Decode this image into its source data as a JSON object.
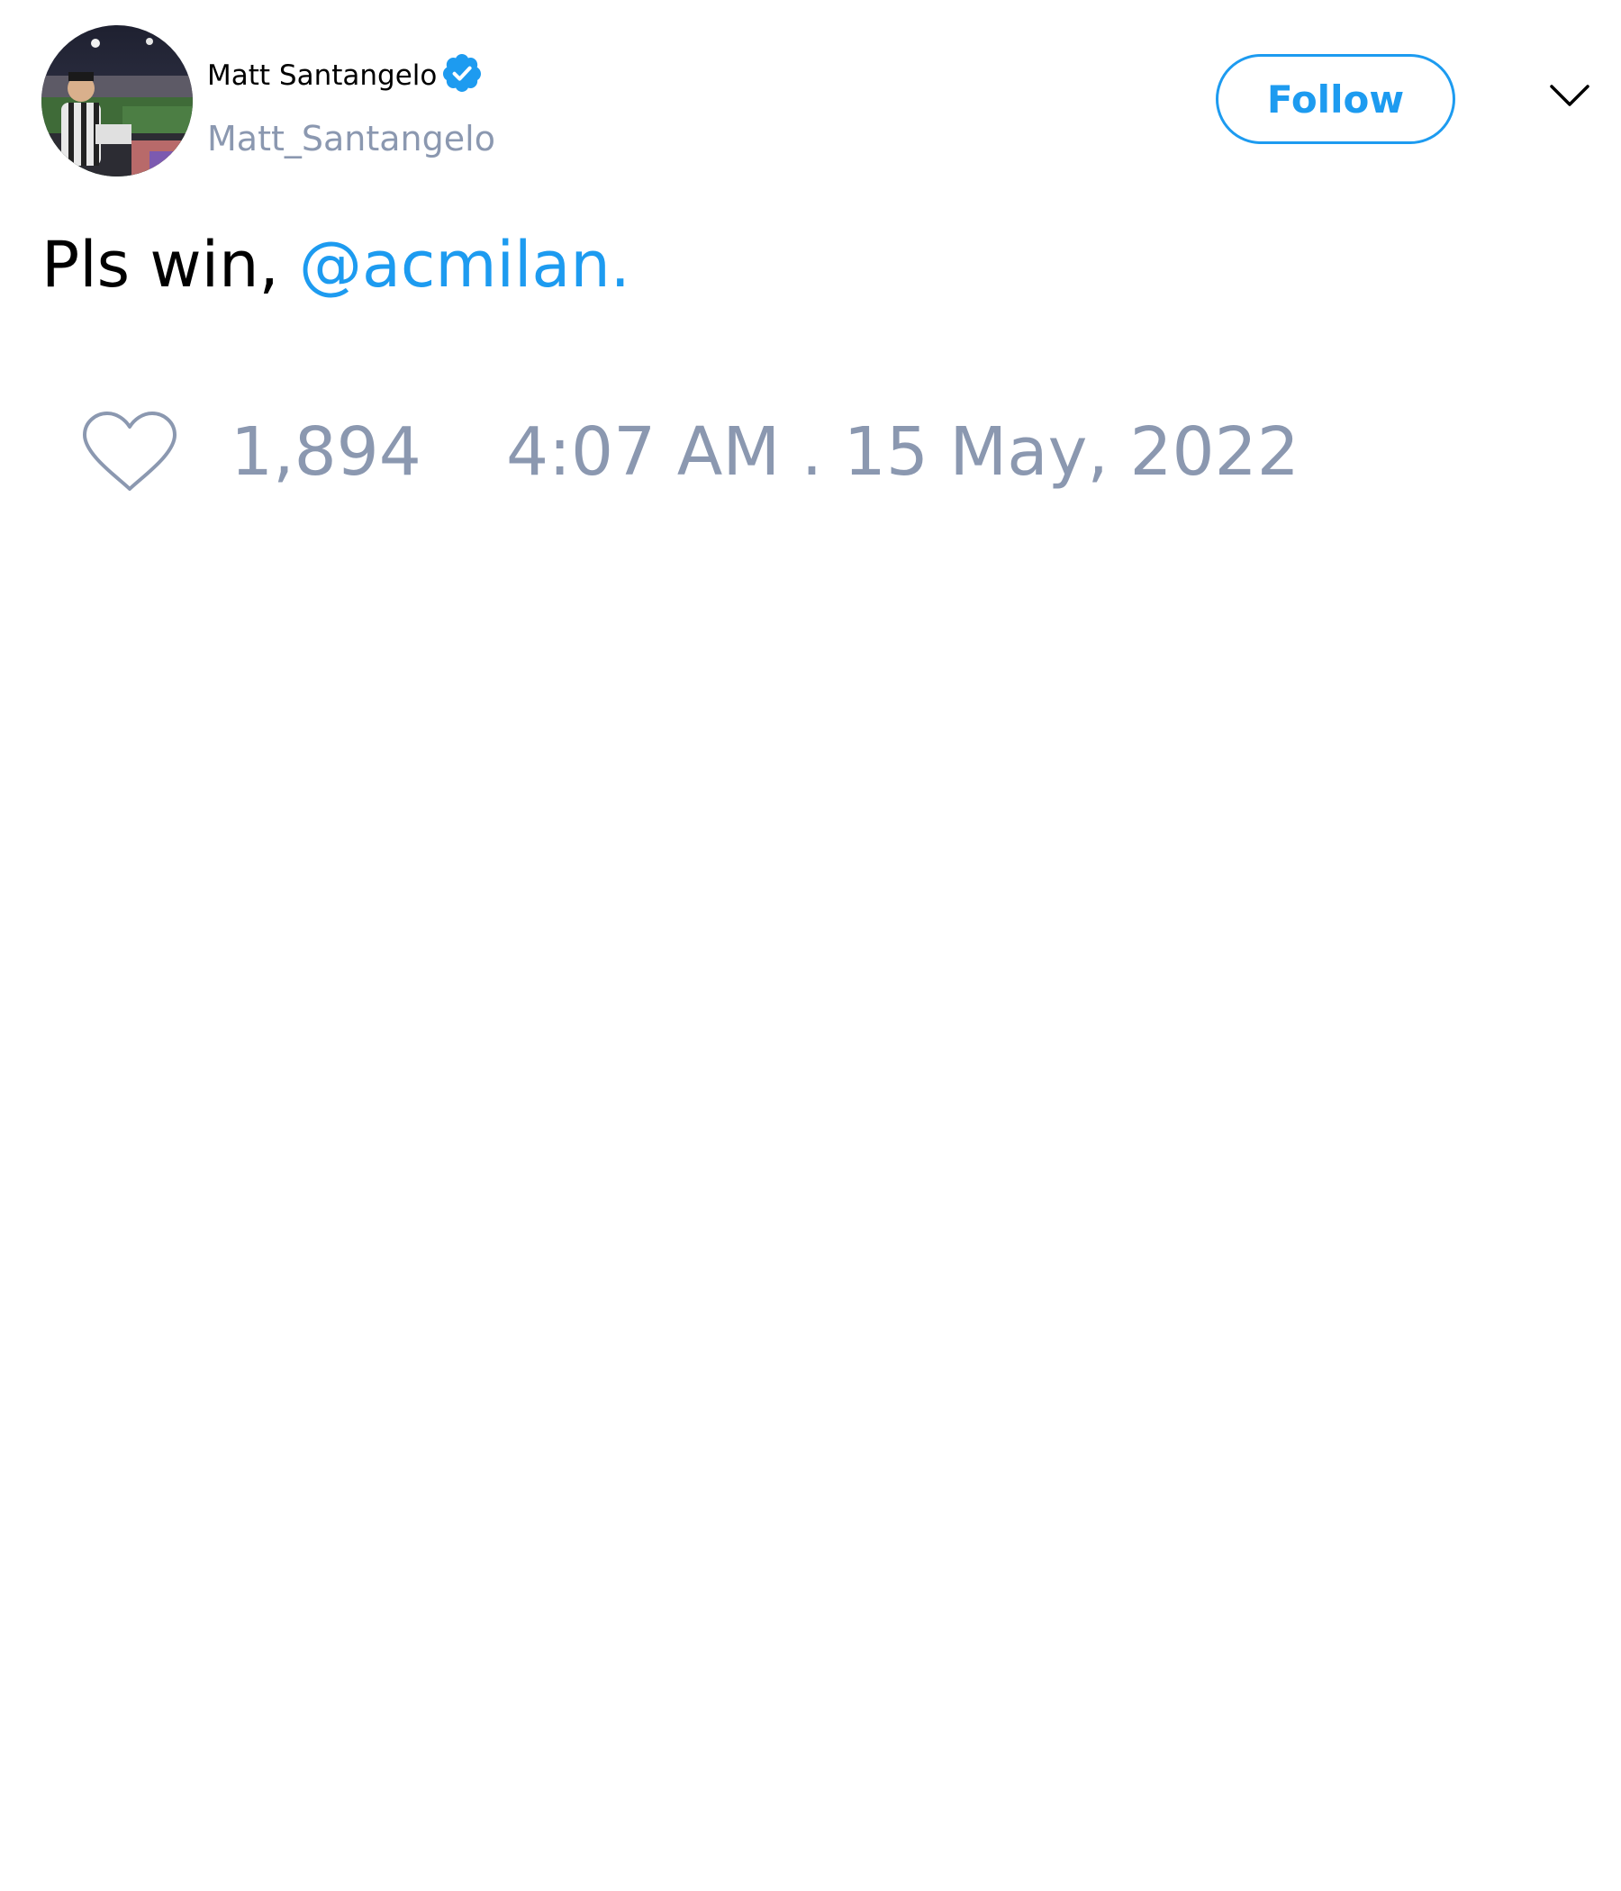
{
  "tweet": {
    "author": {
      "display_name": "Matt Santangelo",
      "handle": "Matt_Santangelo",
      "verified": true,
      "avatar_icon": "profile-photo-stadium"
    },
    "follow_label": "Follow",
    "menu_icon": "chevron-down-icon",
    "text": "Pls win, ",
    "mention": "@acmilan.",
    "like_icon": "heart-outline-icon",
    "likes": "1,894",
    "timestamp": "4:07 AM . 15 May, 2022"
  },
  "colors": {
    "accent": "#1d9bf0",
    "muted": "#8b98b0",
    "text": "#000000",
    "background": "#ffffff"
  }
}
